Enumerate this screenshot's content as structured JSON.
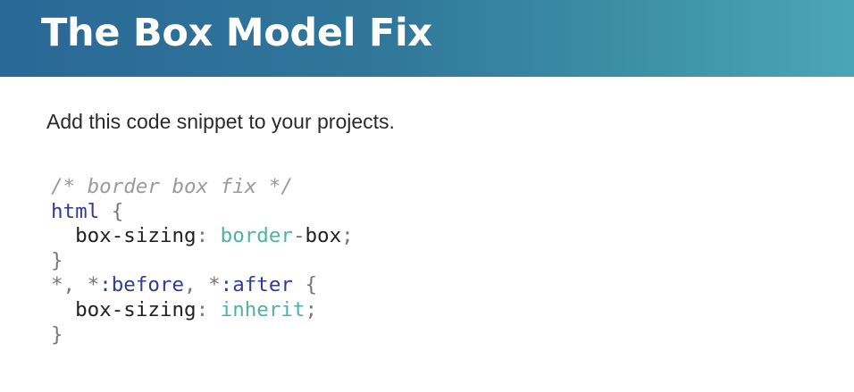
{
  "slide": {
    "title": "The Box Model Fix",
    "subtitle": "Add this code snippet to your projects."
  },
  "code": {
    "comment": "/* border box fix */",
    "rule1_selector": "html",
    "open_brace": "{",
    "close_brace": "}",
    "property": "box-sizing",
    "colon": ":",
    "semicolon": ";",
    "rule1_value_part1": "border",
    "rule1_value_dash": "-",
    "rule1_value_part2": "box",
    "rule2_sel_1": "*",
    "rule2_comma": ",",
    "rule2_sel_2_star": "*",
    "rule2_sel_2_pseudo": ":before",
    "rule2_sel_3_star": "*",
    "rule2_sel_3_pseudo": ":after",
    "rule2_value": "inherit"
  },
  "colors": {
    "header_start": "#2a6897",
    "header_end": "#4aa6b6",
    "comment": "#9a9a9a",
    "selector": "#2f3d99",
    "value": "#4fb3a4"
  }
}
